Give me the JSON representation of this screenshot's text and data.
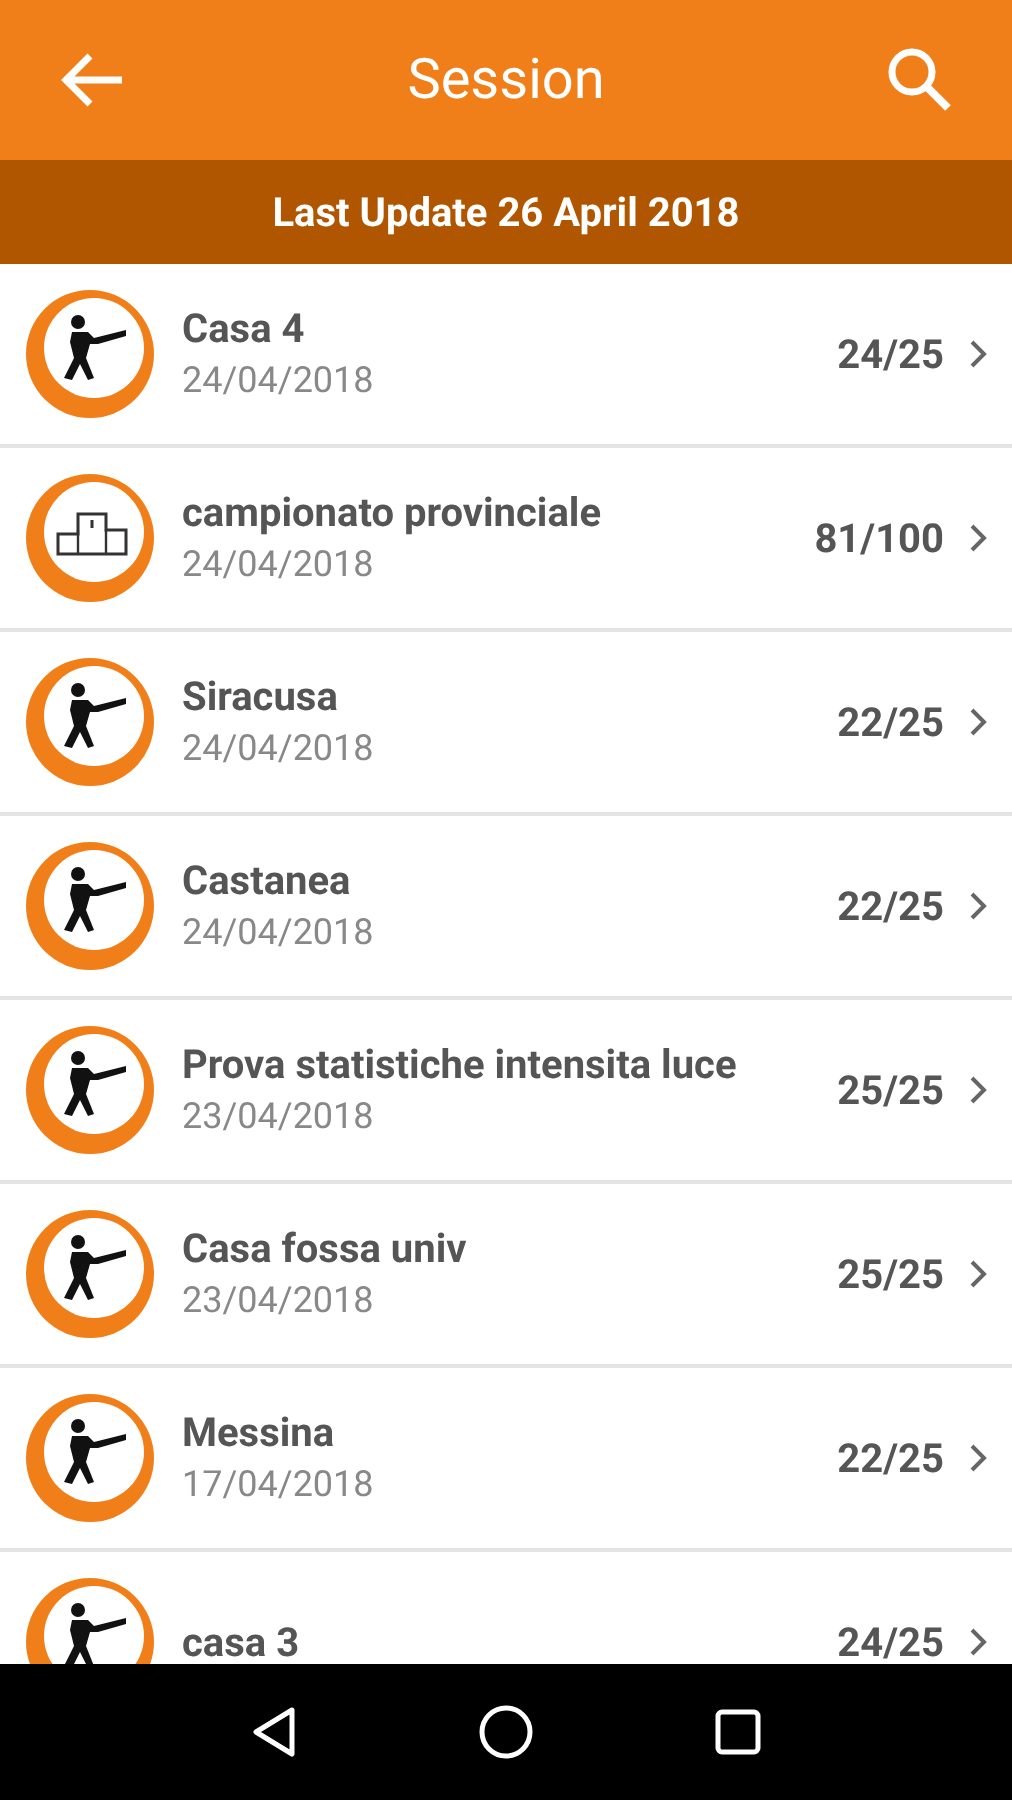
{
  "app_bar": {
    "title": "Session"
  },
  "banner": "Last Update 26 April 2018",
  "sessions": [
    {
      "kind": "shooter",
      "name": "Casa 4",
      "date": "24/04/2018",
      "score": "24/25"
    },
    {
      "kind": "podium",
      "name": "campionato provinciale",
      "date": "24/04/2018",
      "score": "81/100"
    },
    {
      "kind": "shooter",
      "name": "Siracusa",
      "date": "24/04/2018",
      "score": "22/25"
    },
    {
      "kind": "shooter",
      "name": "Castanea",
      "date": "24/04/2018",
      "score": "22/25"
    },
    {
      "kind": "shooter",
      "name": "Prova statistiche intensita luce",
      "date": "23/04/2018",
      "score": "25/25"
    },
    {
      "kind": "shooter",
      "name": "Casa fossa univ",
      "date": "23/04/2018",
      "score": "25/25"
    },
    {
      "kind": "shooter",
      "name": "Messina",
      "date": "17/04/2018",
      "score": "22/25"
    },
    {
      "kind": "shooter",
      "name": "casa 3",
      "score": "24/25"
    }
  ]
}
